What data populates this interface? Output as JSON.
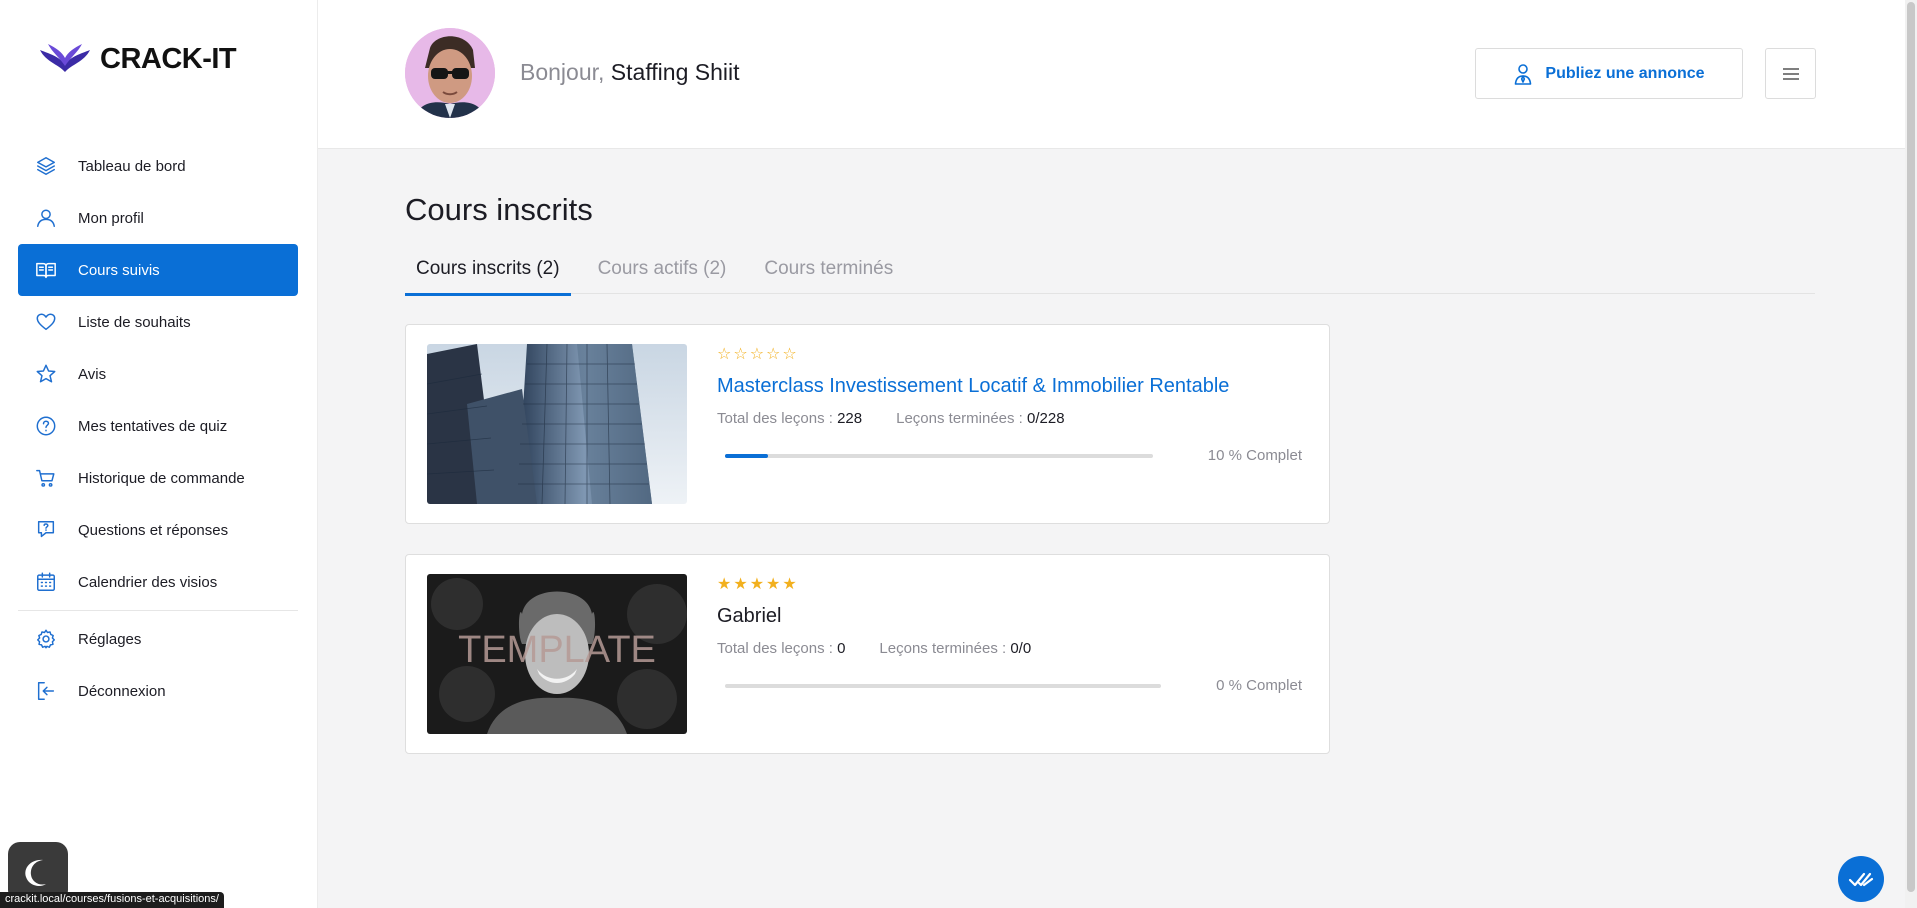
{
  "brand": {
    "name": "CRACK-IT",
    "accent": "#0a6fd6"
  },
  "header": {
    "greeting": "Bonjour,",
    "user_name": "Staffing Shiit",
    "publish_label": "Publiez une annonce"
  },
  "sidebar": {
    "items": [
      {
        "label": "Tableau de bord",
        "icon": "layers-icon"
      },
      {
        "label": "Mon profil",
        "icon": "user-icon"
      },
      {
        "label": "Cours suivis",
        "icon": "book-icon",
        "active": true
      },
      {
        "label": "Liste de souhaits",
        "icon": "heart-icon"
      },
      {
        "label": "Avis",
        "icon": "star-icon"
      },
      {
        "label": "Mes tentatives de quiz",
        "icon": "question-icon"
      },
      {
        "label": "Historique de commande",
        "icon": "cart-icon"
      },
      {
        "label": "Questions et réponses",
        "icon": "qa-icon"
      },
      {
        "label": "Calendrier des visios",
        "icon": "calendar-icon"
      }
    ],
    "bottom_items": [
      {
        "label": "Réglages",
        "icon": "gear-icon"
      },
      {
        "label": "Déconnexion",
        "icon": "logout-icon"
      }
    ]
  },
  "main": {
    "title": "Cours inscrits",
    "tabs": [
      {
        "label": "Cours inscrits (2)",
        "active": true
      },
      {
        "label": "Cours actifs (2)"
      },
      {
        "label": "Cours terminés"
      }
    ],
    "courses": [
      {
        "title": "Masterclass Investissement Locatif & Immobilier Rentable",
        "rating": 0,
        "total_label": "Total des leçons :",
        "total_value": "228",
        "done_label": "Leçons terminées :",
        "done_value": "0/228",
        "progress": 10,
        "progress_text": "10 % Complet",
        "image": "building-photo"
      },
      {
        "title": "Gabriel",
        "rating": 5,
        "total_label": "Total des leçons :",
        "total_value": "0",
        "done_label": "Leçons terminées :",
        "done_value": "0/0",
        "progress": 0,
        "progress_text": "0 % Complet",
        "image": "portrait-photo",
        "image_overlay": "TEMPLATE"
      }
    ]
  },
  "status_bar": {
    "url": "crackit.local/courses/fusions-et-acquisitions/"
  }
}
